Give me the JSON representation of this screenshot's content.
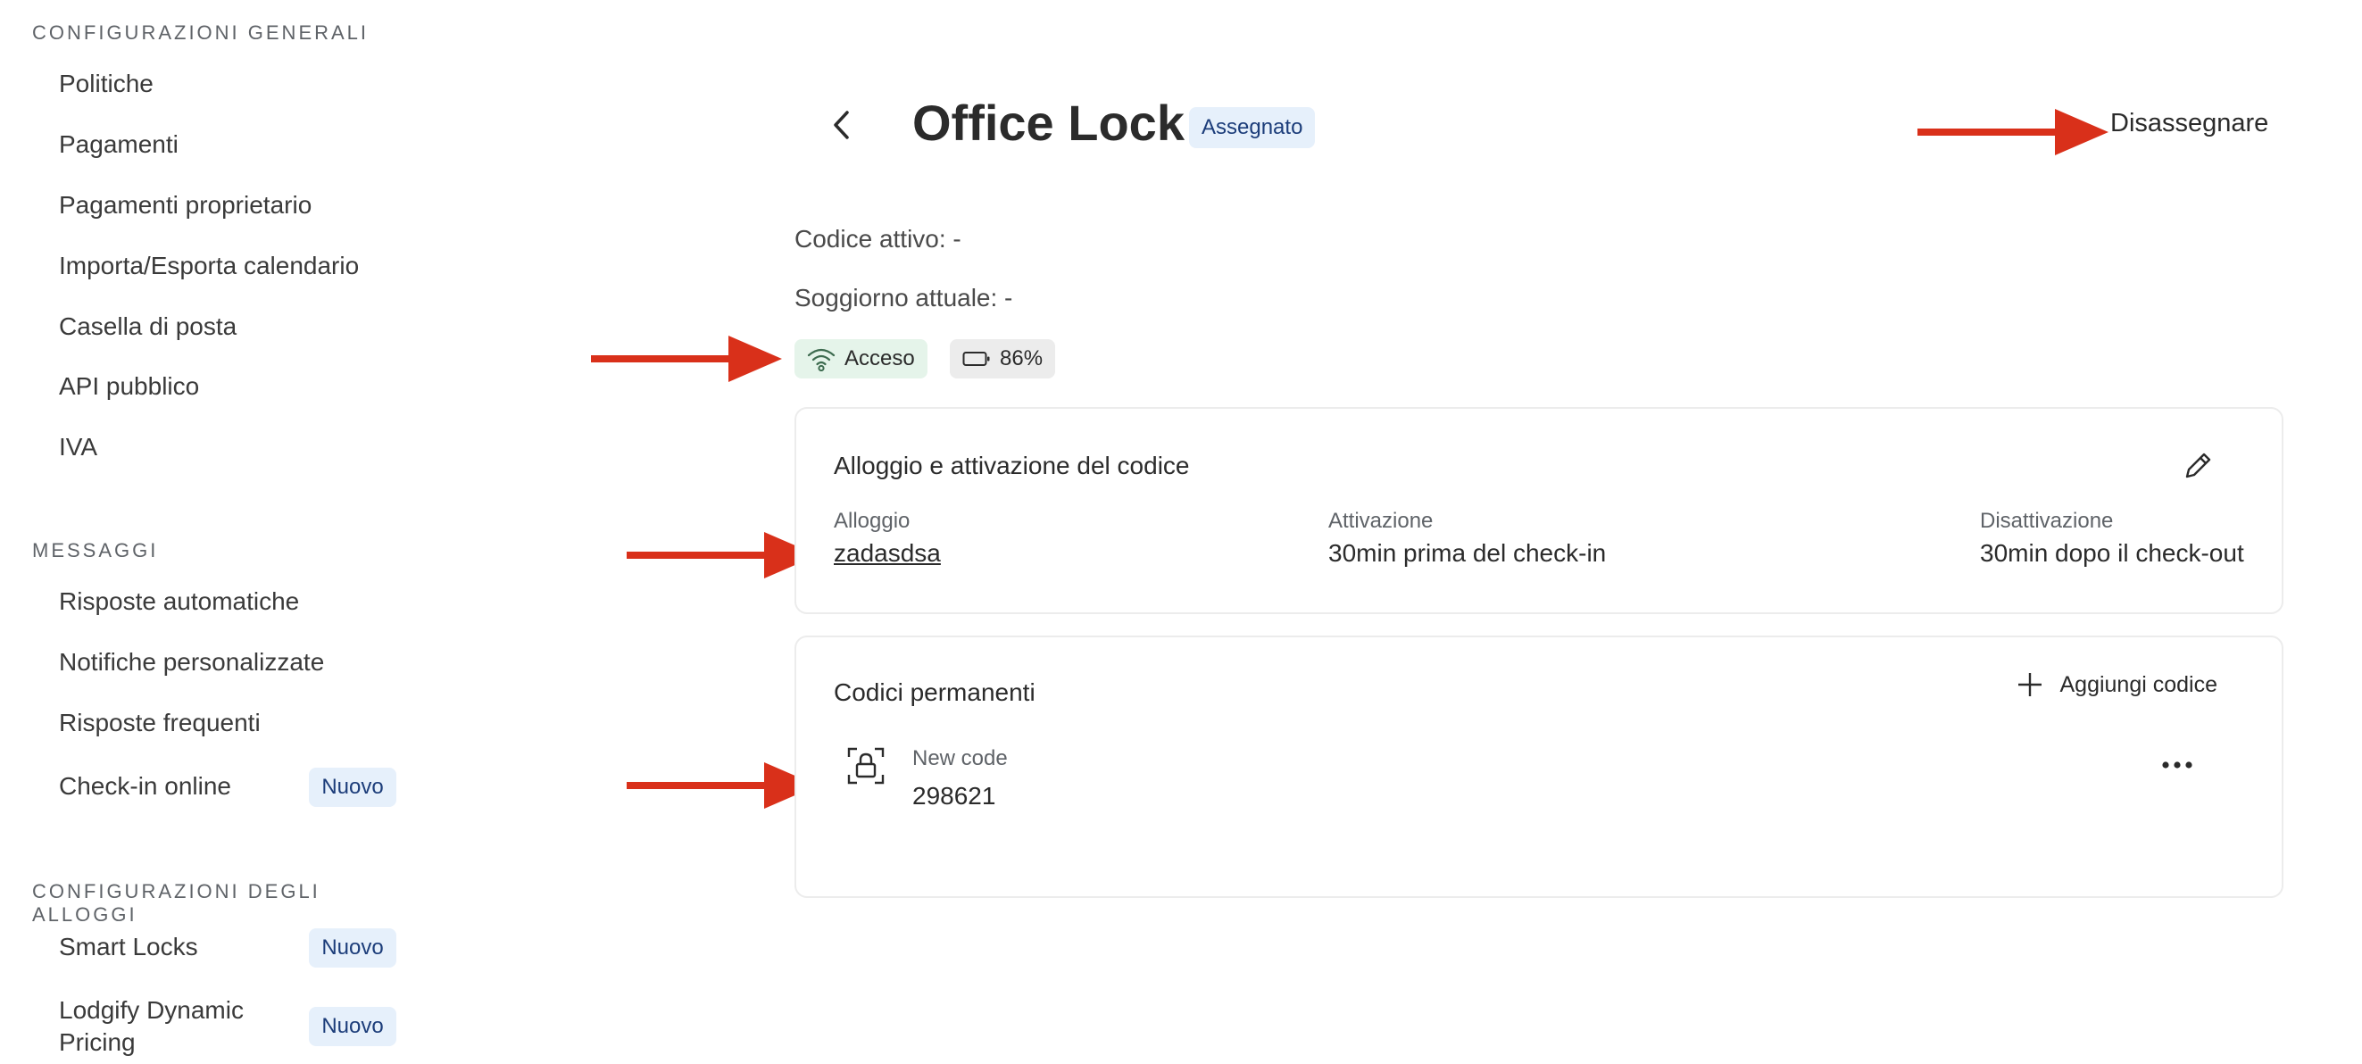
{
  "sidebar": {
    "sections": [
      {
        "title": "CONFIGURAZIONI GENERALI",
        "items": [
          {
            "label": "Politiche"
          },
          {
            "label": "Pagamenti"
          },
          {
            "label": "Pagamenti proprietario"
          },
          {
            "label": "Importa/Esporta calendario"
          },
          {
            "label": "Casella di posta"
          },
          {
            "label": "API pubblico"
          },
          {
            "label": "IVA"
          }
        ]
      },
      {
        "title": "MESSAGGI",
        "items": [
          {
            "label": "Risposte automatiche"
          },
          {
            "label": "Notifiche personalizzate"
          },
          {
            "label": "Risposte frequenti"
          },
          {
            "label": "Check-in online",
            "badge": "Nuovo"
          }
        ]
      },
      {
        "title": "CONFIGURAZIONI DEGLI ALLOGGI",
        "items": [
          {
            "label": "Smart Locks",
            "badge": "Nuovo"
          },
          {
            "label_line1": "Lodgify Dynamic",
            "label_line2": "Pricing",
            "badge": "Nuovo"
          }
        ]
      }
    ]
  },
  "header": {
    "title": "Office Lock",
    "status_badge": "Assegnato",
    "unassign_label": "Disassegnare"
  },
  "info": {
    "active_code": "Codice attivo: -",
    "current_stay": "Soggiorno attuale: -",
    "connection_status": "Acceso",
    "battery": "86%"
  },
  "property_card": {
    "title": "Alloggio e attivazione del codice",
    "property_label": "Alloggio",
    "property_value": "zadasdsa",
    "activation_label": "Attivazione",
    "activation_value": "30min prima del check-in",
    "deactivation_label": "Disattivazione",
    "deactivation_value": "30min dopo il check-out"
  },
  "codes_card": {
    "title": "Codici permanenti",
    "add_label": "Aggiungi codice",
    "codes": [
      {
        "name": "New code",
        "value": "298621"
      }
    ]
  },
  "colors": {
    "accent_badge_bg": "#e6f0fb",
    "accent_badge_text": "#1c3d7a",
    "online_bg": "#e5f4ea",
    "arrow": "#d9301a"
  },
  "icons": [
    "chevron-left-icon",
    "wifi-icon",
    "battery-icon",
    "pencil-icon",
    "plus-icon",
    "lock-code-icon",
    "more-options-icon",
    "arrow-icon"
  ]
}
